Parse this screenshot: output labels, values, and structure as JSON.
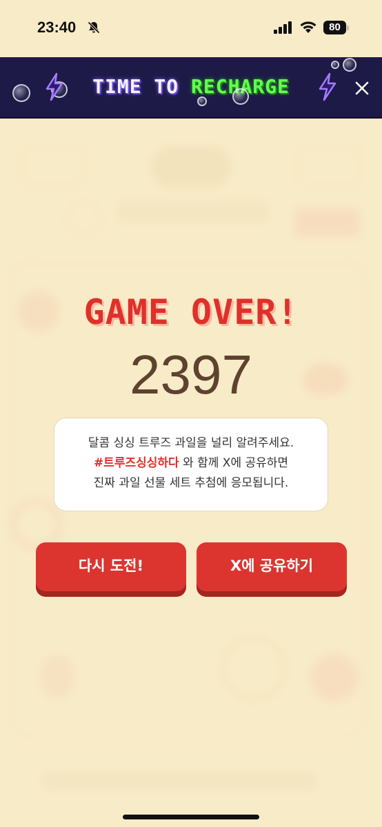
{
  "status_bar": {
    "time": "23:40",
    "battery": "80"
  },
  "banner": {
    "text_primary": "TIME TO ",
    "text_accent": "RECHARGE"
  },
  "overlay": {
    "title": "GAME OVER!",
    "score": "2397",
    "message": {
      "line1": "달콤 싱싱 트루즈 과일을 널리 알려주세요.",
      "hashtag": "#트루즈싱싱하다",
      "line2_rest": " 와 함께 X에 공유하면",
      "line3": "진짜 과일 선물 세트 추첨에 응모됩니다."
    },
    "retry_label": "다시 도전!",
    "share_label": "X에 공유하기"
  },
  "colors": {
    "accent_red": "#dc3530",
    "banner_bg": "#1d1a48",
    "page_bg": "#f6e9c6",
    "banner_green": "#63ff52"
  },
  "icons": [
    "bell-slash-icon",
    "signal-icon",
    "wifi-icon",
    "battery-icon",
    "lightning-icon",
    "close-icon"
  ]
}
